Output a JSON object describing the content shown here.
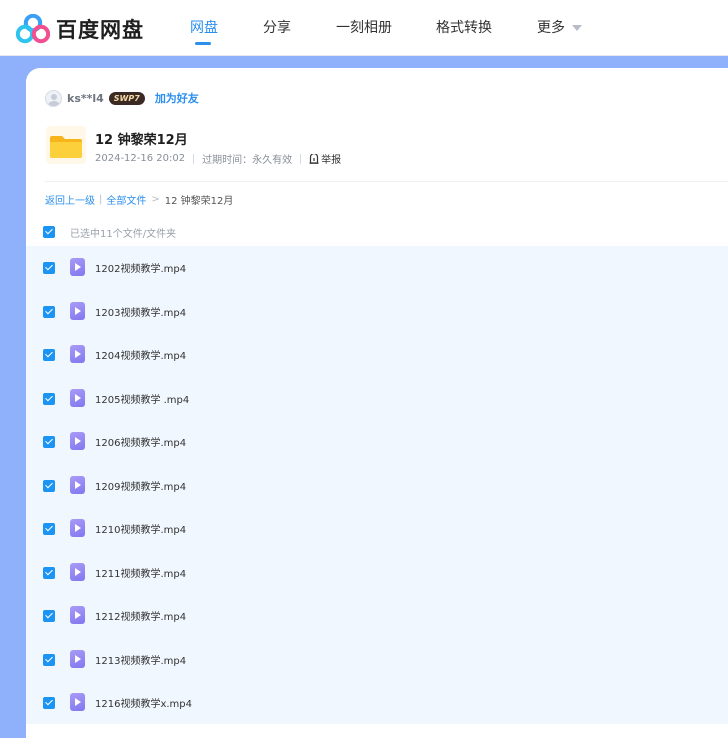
{
  "header": {
    "logo_text": "百度网盘",
    "nav": [
      {
        "label": "网盘",
        "active": true
      },
      {
        "label": "分享",
        "active": false
      },
      {
        "label": "一刻相册",
        "active": false
      },
      {
        "label": "格式转换",
        "active": false
      },
      {
        "label": "更多",
        "active": false
      }
    ],
    "accent_color": "#2c8fee"
  },
  "share": {
    "sharer_name": "ks**l4",
    "badge": "SWP7",
    "add_friend": "加为好友",
    "folder_title": "12 钟黎荣12月",
    "shared_at": "2024-12-16 20:02",
    "expiry_label": "过期时间：永久有效",
    "report": "举报"
  },
  "breadcrumb": {
    "back": "返回上一级",
    "all_files": "全部文件",
    "current": "12 钟黎荣12月"
  },
  "selection": {
    "summary": "已选中11个文件/文件夹"
  },
  "files": [
    {
      "name": "1202视频教学.mp4",
      "checked": true
    },
    {
      "name": "1203视频教学.mp4",
      "checked": true
    },
    {
      "name": "1204视频教学.mp4",
      "checked": true
    },
    {
      "name": "1205视频教学 .mp4",
      "checked": true
    },
    {
      "name": "1206视频教学.mp4",
      "checked": true
    },
    {
      "name": "1209视频教学.mp4",
      "checked": true
    },
    {
      "name": "1210视频教学.mp4",
      "checked": true
    },
    {
      "name": "1211视频教学.mp4",
      "checked": true
    },
    {
      "name": "1212视频教学.mp4",
      "checked": true
    },
    {
      "name": "1213视频教学.mp4",
      "checked": true
    },
    {
      "name": "1216视频教学x.mp4",
      "checked": true
    }
  ],
  "icons": {
    "logo": "baidu-netdisk-logo-icon",
    "folder": "folder-icon",
    "video": "video-file-icon",
    "report": "report-flag-icon",
    "checkbox": "checkbox-checked-icon"
  },
  "colors": {
    "page_background": "#8fb1fb",
    "list_background": "#f0f7fe",
    "checkbox": "#1c94f4",
    "video_icon": "#8a7ff1",
    "folder": "#f9c623"
  }
}
